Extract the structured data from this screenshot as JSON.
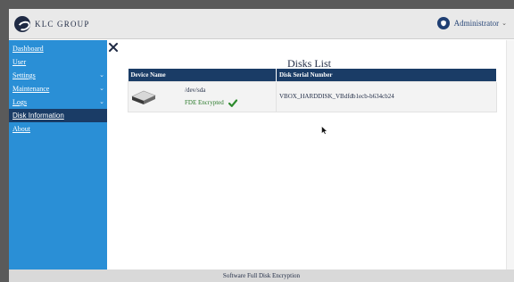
{
  "header": {
    "logo_text": "KLC GROUP",
    "user_label": "Administrator",
    "user_caret": "⌄"
  },
  "sidebar": {
    "items": [
      {
        "label": "Dashboard",
        "underline_first": true
      },
      {
        "label": "User",
        "underline_first": true
      },
      {
        "label": "Settings",
        "underline_first": true,
        "chevron": "⌄"
      },
      {
        "label": "Maintenance",
        "underline_first": true,
        "chevron": "⌄"
      },
      {
        "label": "Logs",
        "underline_first": false,
        "chevron": "⌄"
      },
      {
        "label": "Disk Information",
        "active": true
      },
      {
        "label": "About",
        "underline_first": true
      }
    ]
  },
  "main": {
    "title": "Disks List",
    "table": {
      "headers": [
        "Device Name",
        "Disk Serial Number"
      ],
      "rows": [
        {
          "device_path": "/dev/sda",
          "status": "FDE Encrypted",
          "serial": "VBOX_HARDDISK_VBdfdb1ecb-b634cb24"
        }
      ]
    }
  },
  "footer": {
    "text": "Software Full Disk Encryption"
  },
  "icons": {
    "logo": "klc-logo-icon",
    "user": "shield-user-icon",
    "close": "close-icon",
    "disk": "hard-disk-icon",
    "check": "checkmark-icon"
  },
  "colors": {
    "sidebar": "#2a8fd6",
    "active_nav": "#1a3c66",
    "table_header": "#1a3c66",
    "status_green": "#2a7a2a"
  }
}
